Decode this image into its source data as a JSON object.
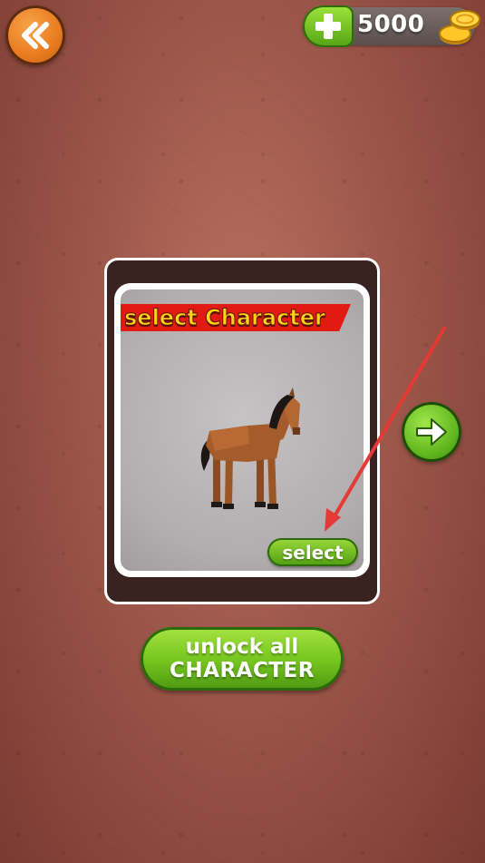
{
  "header": {
    "back_icon": "double-chevron-left-icon",
    "coins": {
      "add_icon": "plus-icon",
      "amount": "5000",
      "coin_icon": "gold-coins-icon"
    }
  },
  "character_panel": {
    "title": "select Character",
    "character_name_icon": "horse-character",
    "select_label": "select"
  },
  "navigation": {
    "next_icon": "arrow-right-icon"
  },
  "unlock_all": {
    "line1": "unlock all",
    "line2": "CHARACTER"
  },
  "colors": {
    "orange": "#ea7c1f",
    "green": "#74c41e",
    "red_banner": "#e21b12",
    "title_yellow": "#ffd21a",
    "annotation_red": "#e53935"
  }
}
